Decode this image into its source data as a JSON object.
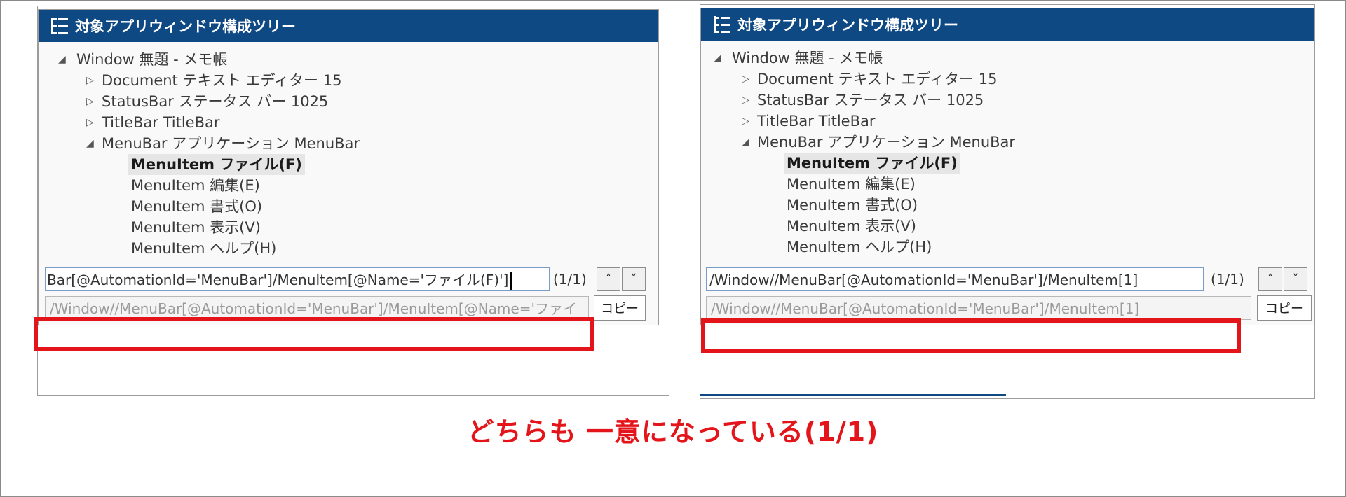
{
  "panels": [
    {
      "header": {
        "title": "対象アプリウィンドウ構成ツリー",
        "icon": "tree-structure-icon"
      },
      "tree": [
        {
          "label": "Window 無題 - メモ帳",
          "arrow": "◢",
          "level": 0
        },
        {
          "label": "Document テキスト エディター 15",
          "arrow": "▷",
          "level": 1
        },
        {
          "label": "StatusBar ステータス バー 1025",
          "arrow": "▷",
          "level": 1
        },
        {
          "label": "TitleBar  TitleBar",
          "arrow": "▷",
          "level": 1
        },
        {
          "label": "MenuBar アプリケーション MenuBar",
          "arrow": "◢",
          "level": 1
        },
        {
          "label": "MenuItem ファイル(F)",
          "arrow": "",
          "level": 2,
          "selected": true
        },
        {
          "label": "MenuItem 編集(E)",
          "arrow": "",
          "level": 2
        },
        {
          "label": "MenuItem 書式(O)",
          "arrow": "",
          "level": 2
        },
        {
          "label": "MenuItem 表示(V)",
          "arrow": "",
          "level": 2
        },
        {
          "label": "MenuItem ヘルプ(H)",
          "arrow": "",
          "level": 2
        }
      ],
      "xpath_value": "Bar[@AutomationId='MenuBar']/MenuItem[@Name='ファイル(F)']",
      "match_count": "(1/1)",
      "result_value": "/Window//MenuBar[@AutomationId='MenuBar']/MenuItem[@Name='ファイ",
      "copy_label": "コピー",
      "up_icon": "chevron-up-icon",
      "down_icon": "chevron-down-icon"
    },
    {
      "header": {
        "title": "対象アプリウィンドウ構成ツリー",
        "icon": "tree-structure-icon"
      },
      "tree": [
        {
          "label": "Window 無題 - メモ帳",
          "arrow": "◢",
          "level": 0
        },
        {
          "label": "Document テキスト エディター 15",
          "arrow": "▷",
          "level": 1
        },
        {
          "label": "StatusBar ステータス バー 1025",
          "arrow": "▷",
          "level": 1
        },
        {
          "label": "TitleBar  TitleBar",
          "arrow": "▷",
          "level": 1
        },
        {
          "label": "MenuBar アプリケーション MenuBar",
          "arrow": "◢",
          "level": 1
        },
        {
          "label": "MenuItem ファイル(F)",
          "arrow": "",
          "level": 2,
          "selected": true
        },
        {
          "label": "MenuItem 編集(E)",
          "arrow": "",
          "level": 2
        },
        {
          "label": "MenuItem 書式(O)",
          "arrow": "",
          "level": 2
        },
        {
          "label": "MenuItem 表示(V)",
          "arrow": "",
          "level": 2
        },
        {
          "label": "MenuItem ヘルプ(H)",
          "arrow": "",
          "level": 2
        }
      ],
      "xpath_value": "/Window//MenuBar[@AutomationId='MenuBar']/MenuItem[1]",
      "match_count": "(1/1)",
      "result_value": "/Window//MenuBar[@AutomationId='MenuBar']/MenuItem[1]",
      "copy_label": "コピー",
      "up_icon": "chevron-up-icon",
      "down_icon": "chevron-down-icon"
    }
  ],
  "caption": "どちらも 一意になっている(1/1)",
  "colors": {
    "header_bg": "#0e4984",
    "highlight": "#e3141a",
    "caption": "#e3141a"
  }
}
